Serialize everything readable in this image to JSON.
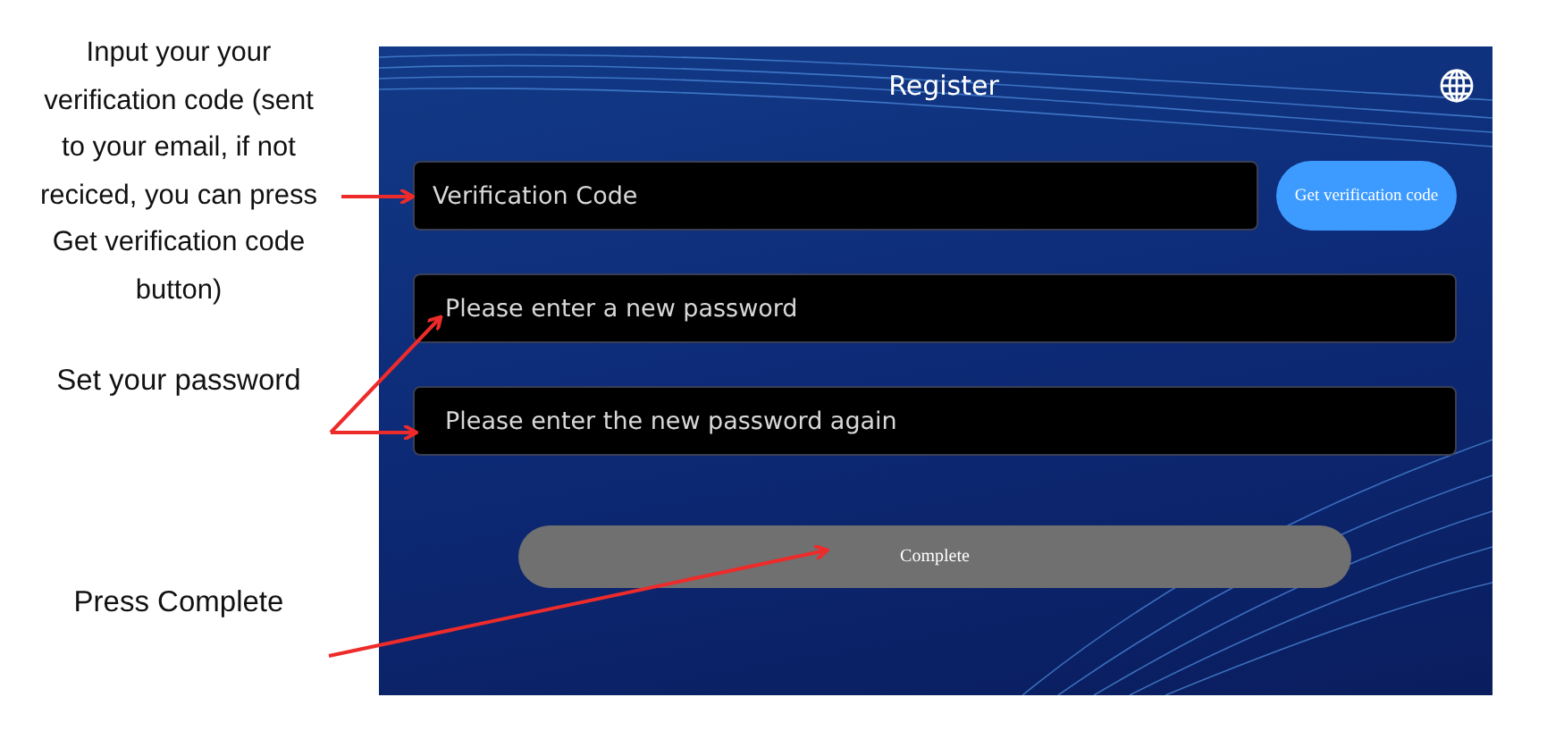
{
  "annotations": [
    {
      "text": "Input your your verification code (sent to your email, if not reciced, you can press Get verification code button)"
    },
    {
      "text": "Set your password"
    },
    {
      "text": "Press Complete"
    }
  ],
  "screen": {
    "title": "Register",
    "fields": [
      {
        "placeholder": "Verification Code"
      },
      {
        "placeholder": "Please enter a new password"
      },
      {
        "placeholder": "Please enter the new password again"
      }
    ],
    "get_code_button": "Get verification code",
    "complete_button": "Complete"
  }
}
